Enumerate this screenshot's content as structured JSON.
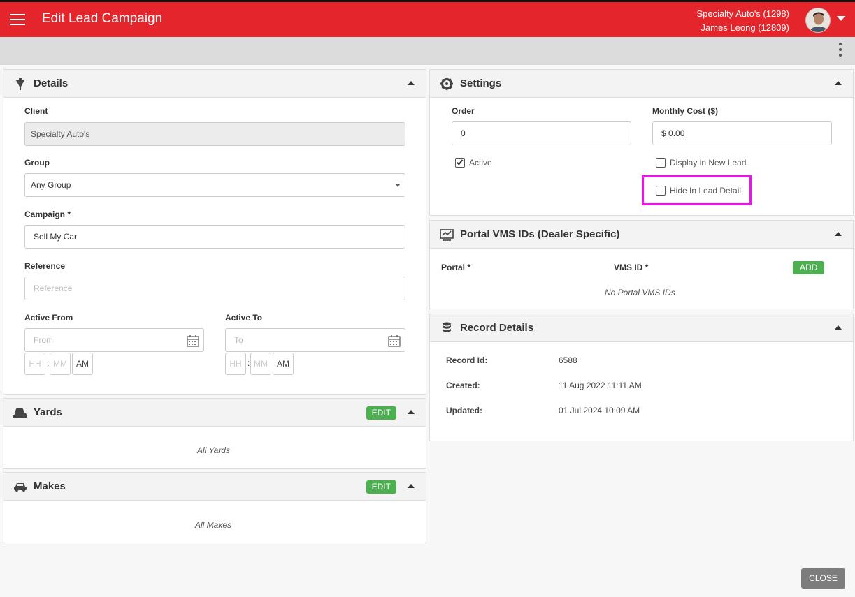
{
  "header": {
    "title": "Edit Lead Campaign",
    "dealer": "Specialty Auto's (1298)",
    "user": "James Leong (12809)"
  },
  "icons": {
    "menu": "hamburger-icon",
    "user_menu": "caret-down-icon",
    "more": "kebab-icon",
    "details": "funnel-icon",
    "settings": "gear-icon",
    "portal": "portal-icon",
    "record": "database-icon",
    "yards": "cars-icon",
    "makes": "car-icon",
    "calendar": "calendar-icon"
  },
  "colors": {
    "brand": "#e4252b",
    "success": "#4caf50",
    "highlight": "#ee11ee"
  },
  "details": {
    "title": "Details",
    "client_label": "Client",
    "client_value": "Specialty Auto's",
    "group_label": "Group",
    "group_value": "Any Group",
    "campaign_label": "Campaign *",
    "campaign_value": "Sell My Car",
    "reference_label": "Reference",
    "reference_placeholder": "Reference",
    "active_from_label": "Active From",
    "active_from_placeholder": "From",
    "active_to_label": "Active To",
    "active_to_placeholder": "To",
    "hh": "HH",
    "mm": "MM",
    "ampm": "AM",
    "colon": ":"
  },
  "yards": {
    "title": "Yards",
    "edit_label": "EDIT",
    "empty": "All Yards"
  },
  "makes": {
    "title": "Makes",
    "edit_label": "EDIT",
    "empty": "All Makes"
  },
  "settings": {
    "title": "Settings",
    "order_label": "Order",
    "order_value": "0",
    "monthly_cost_label": "Monthly Cost ($)",
    "monthly_cost_value": "$ 0.00",
    "active_label": "Active",
    "active_checked": true,
    "display_new_lead_label": "Display in New Lead",
    "display_new_lead_checked": false,
    "hide_lead_detail_label": "Hide In Lead Detail",
    "hide_lead_detail_checked": false
  },
  "portal": {
    "title": "Portal VMS IDs (Dealer Specific)",
    "portal_col": "Portal *",
    "vms_col": "VMS ID *",
    "add_label": "ADD",
    "empty": "No Portal VMS IDs"
  },
  "record": {
    "title": "Record Details",
    "id_label": "Record Id:",
    "id_value": "6588",
    "created_label": "Created:",
    "created_value": "11 Aug 2022 11:11 AM",
    "updated_label": "Updated:",
    "updated_value": "01 Jul 2024 10:09 AM"
  },
  "footer": {
    "close_label": "CLOSE"
  }
}
